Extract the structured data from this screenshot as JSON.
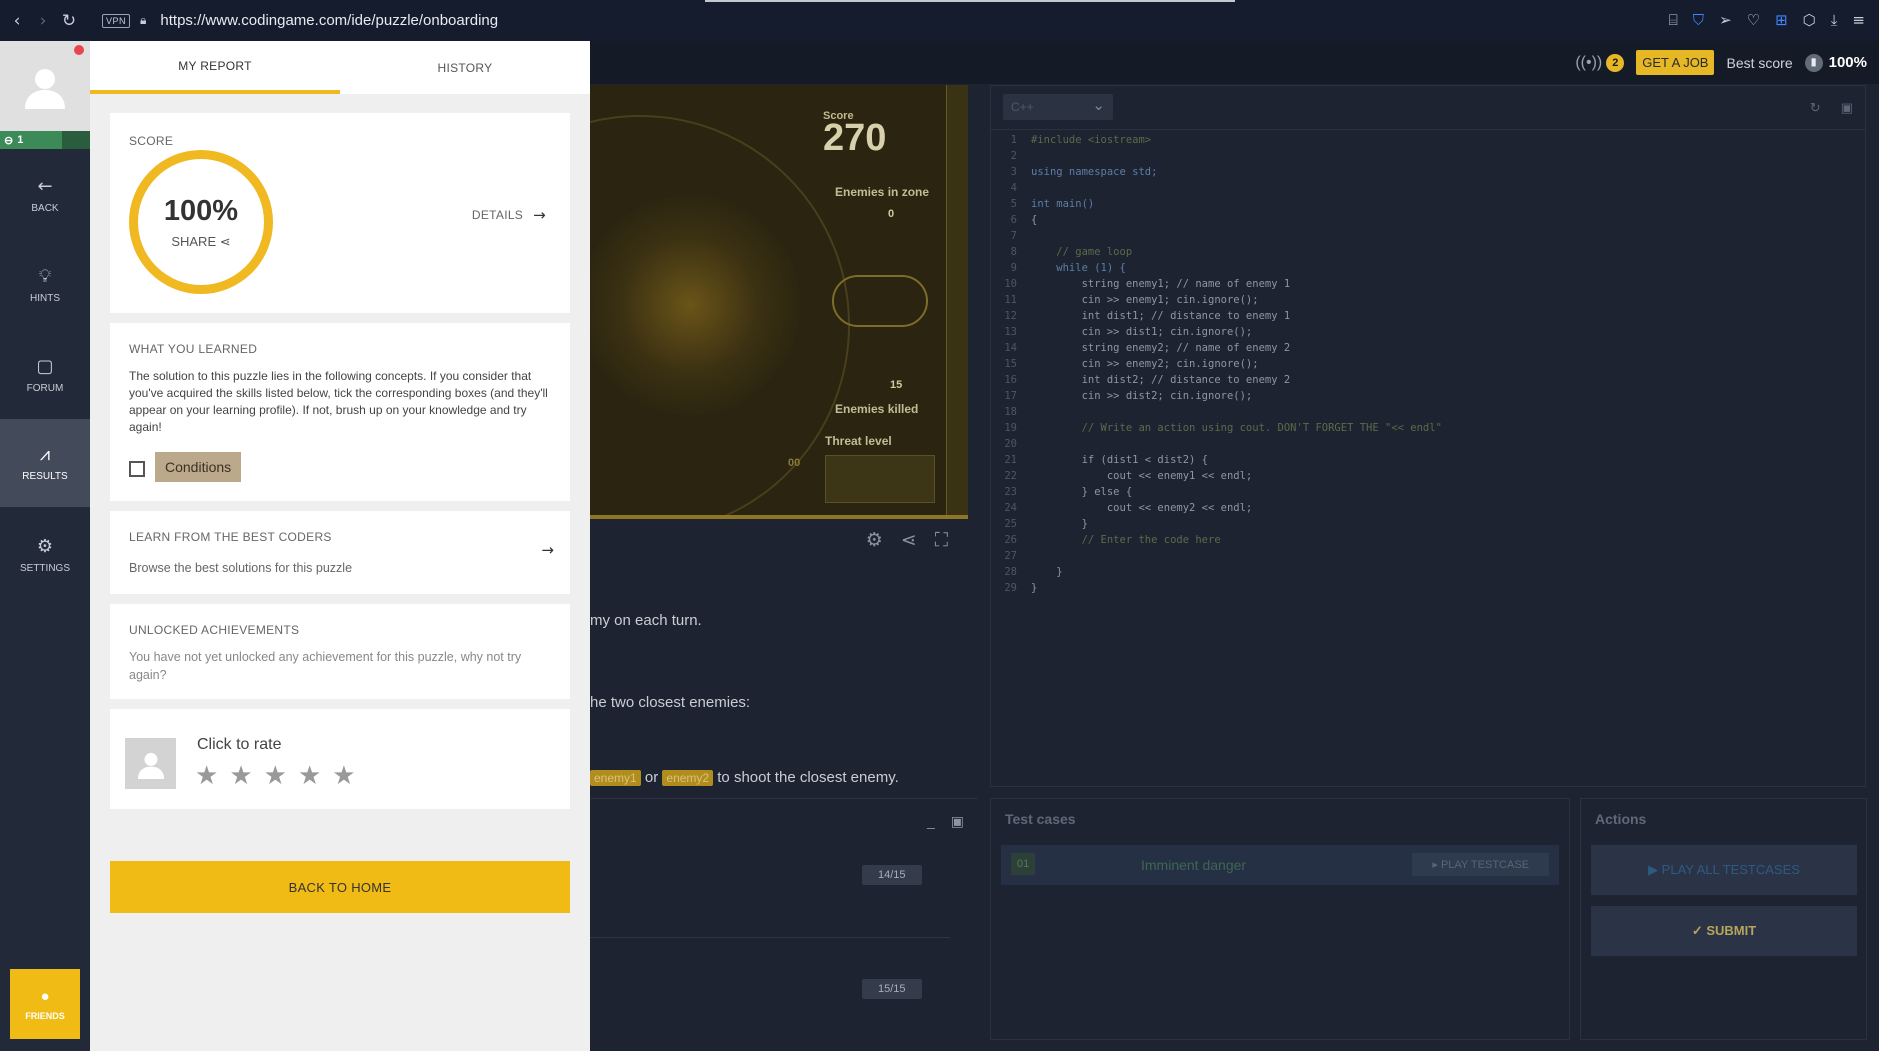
{
  "browser": {
    "url": "https://www.codingame.com/ide/puzzle/onboarding",
    "vpn_label": "VPN"
  },
  "ide_header": {
    "signal_count": "2",
    "get_job_label": "GET A JOB",
    "best_score_label": "Best score",
    "best_score_value": "100%"
  },
  "sidebar": {
    "level": "1",
    "items": [
      {
        "label": "BACK",
        "icon": "back-arrow-icon"
      },
      {
        "label": "HINTS",
        "icon": "lightbulb-icon"
      },
      {
        "label": "FORUM",
        "icon": "forum-icon"
      },
      {
        "label": "RESULTS",
        "icon": "chart-line-icon"
      },
      {
        "label": "SETTINGS",
        "icon": "gear-icon"
      }
    ],
    "friends_label": "FRIENDS"
  },
  "report": {
    "tabs": [
      "MY REPORT",
      "HISTORY"
    ],
    "score": {
      "title": "SCORE",
      "value": "100%",
      "share_label": "SHARE",
      "details_label": "DETAILS"
    },
    "learned": {
      "title": "WHAT YOU LEARNED",
      "text": "The solution to this puzzle lies in the following concepts. If you consider that you've acquired the skills listed below, tick the corresponding boxes (and they'll appear on your learning profile). If not, brush up on your knowledge and try again!",
      "concept": "Conditions"
    },
    "best_coders": {
      "title": "LEARN FROM THE BEST CODERS",
      "text": "Browse the best solutions for this puzzle"
    },
    "achievements": {
      "title": "UNLOCKED ACHIEVEMENTS",
      "text": "You have not yet unlocked any achievement for this puzzle, why not try again?"
    },
    "rating": {
      "title": "Click to rate",
      "stars": 5
    },
    "back_home_label": "BACK TO HOME"
  },
  "viewer": {
    "score_label": "Score",
    "score_value": "270",
    "enemies_in_zone_label": "Enemies in zone",
    "enemies_in_zone_value": "0",
    "enemies_killed_value": "15",
    "enemies_killed_label": "Enemies killed",
    "threat_label": "Threat level",
    "threat_value": "00"
  },
  "statement": {
    "line1": "my on each turn.",
    "line2": "he two closest enemies:",
    "chip1": "enemy1",
    "or_text": "or",
    "chip2": "enemy2",
    "line3": "to shoot the closest enemy."
  },
  "console": {
    "frame1": "14/15",
    "frame2": "15/15"
  },
  "editor": {
    "language": "C++",
    "lines": [
      {
        "t": "#include <iostream>",
        "c": "cm"
      },
      {
        "t": "",
        "c": ""
      },
      {
        "t": "using namespace std;",
        "c": "kw"
      },
      {
        "t": "",
        "c": ""
      },
      {
        "t": "int main()",
        "c": "kw"
      },
      {
        "t": "{",
        "c": ""
      },
      {
        "t": "",
        "c": ""
      },
      {
        "t": "    // game loop",
        "c": "cm"
      },
      {
        "t": "    while (1) {",
        "c": "kw"
      },
      {
        "t": "        string enemy1; // name of enemy 1",
        "c": ""
      },
      {
        "t": "        cin >> enemy1; cin.ignore();",
        "c": ""
      },
      {
        "t": "        int dist1; // distance to enemy 1",
        "c": ""
      },
      {
        "t": "        cin >> dist1; cin.ignore();",
        "c": ""
      },
      {
        "t": "        string enemy2; // name of enemy 2",
        "c": ""
      },
      {
        "t": "        cin >> enemy2; cin.ignore();",
        "c": ""
      },
      {
        "t": "        int dist2; // distance to enemy 2",
        "c": ""
      },
      {
        "t": "        cin >> dist2; cin.ignore();",
        "c": ""
      },
      {
        "t": "",
        "c": ""
      },
      {
        "t": "        // Write an action using cout. DON'T FORGET THE \"<< endl\"",
        "c": "cm"
      },
      {
        "t": "",
        "c": ""
      },
      {
        "t": "        if (dist1 < dist2) {",
        "c": ""
      },
      {
        "t": "            cout << enemy1 << endl;",
        "c": ""
      },
      {
        "t": "        } else {",
        "c": ""
      },
      {
        "t": "            cout << enemy2 << endl;",
        "c": ""
      },
      {
        "t": "        }",
        "c": ""
      },
      {
        "t": "        // Enter the code here",
        "c": "cm"
      },
      {
        "t": "",
        "c": ""
      },
      {
        "t": "    }",
        "c": ""
      },
      {
        "t": "}",
        "c": ""
      }
    ]
  },
  "testcases": {
    "title": "Test cases",
    "items": [
      {
        "num": "01",
        "name": "Imminent danger",
        "play_label": "▸ PLAY TESTCASE"
      }
    ]
  },
  "actions": {
    "title": "Actions",
    "play_all_label": "▶ PLAY ALL TESTCASES",
    "submit_label": "✓ SUBMIT"
  }
}
